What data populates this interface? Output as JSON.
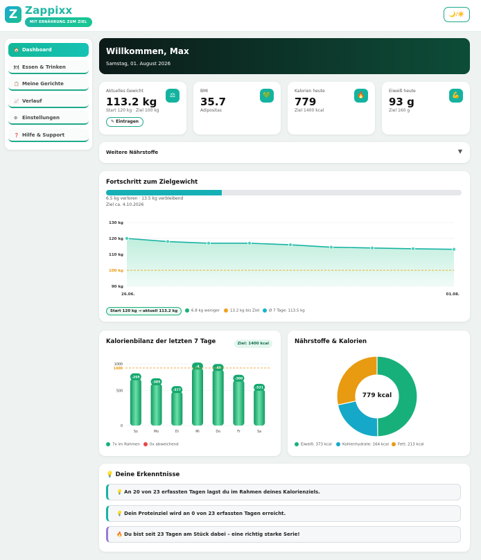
{
  "app": {
    "name": "Zappixx",
    "tagline": "MIT ERNÄHRUNG ZUM ZIEL",
    "theme_toggle": "🌙/☀️"
  },
  "sidebar": {
    "items": [
      {
        "label": "Dashboard",
        "icon": "🏠"
      },
      {
        "label": "Essen & Trinken",
        "icon": "🍽"
      },
      {
        "label": "Meine Gerichte",
        "icon": "📋"
      },
      {
        "label": "Verlauf",
        "icon": "📈"
      },
      {
        "label": "Einstellungen",
        "icon": "⚙"
      },
      {
        "label": "Hilfe & Support",
        "icon": "❓"
      }
    ]
  },
  "welcome": {
    "title": "Willkommen, Max",
    "date": "Samstag, 01. August 2026"
  },
  "stats": [
    {
      "label": "Aktuelles Gewicht",
      "value": "113.2 kg",
      "sub": "Start 120 kg · Ziel 100 kg",
      "icon": "⚖"
    },
    {
      "label": "BMI",
      "value": "35.7",
      "sub": "Adipositas",
      "icon": "💚"
    },
    {
      "label": "Kalorien heute",
      "value": "779",
      "sub": "Ziel 1400 kcal",
      "icon": "🔥"
    },
    {
      "label": "Eiweiß heute",
      "value": "93 g",
      "sub": "Ziel 160 g",
      "icon": "💪"
    }
  ],
  "entry_button": "✎ Eintragen",
  "nutrients_toggle": {
    "label": "Weitere Nährstoffe",
    "chevron": "▼"
  },
  "weight_progress": {
    "title": "Fortschritt zum Zielgewicht",
    "progress_fraction": 0.325,
    "lost_text": "6.5 kg verloren · 13.5 kg verbleibend",
    "goal_date": "Ziel ca. 4.10.2026",
    "badge": "Start 120 kg → aktuell 113.2 kg",
    "legend": [
      {
        "label": "6.8 kg weniger",
        "color": "#18b07a"
      },
      {
        "label": "13.2 kg bis Ziel",
        "color": "#f0a020"
      },
      {
        "label": "Ø 7 Tage: 113.5 kg",
        "color": "#16b3c8"
      }
    ]
  },
  "calorie_balance": {
    "title": "Kalorienbilanz der letzten 7 Tage",
    "goal_badge": "Ziel: 1400 kcal",
    "legend": [
      {
        "label": "7x im Rahmen",
        "color": "#18b07a"
      },
      {
        "label": "0x abweichend",
        "color": "#e84545"
      }
    ]
  },
  "macros": {
    "title": "Nährstoffe & Kalorien",
    "center": "779 kcal",
    "legend": [
      {
        "label": "Eiweiß: 373 kcal",
        "color": "#18b07a"
      },
      {
        "label": "Kohlenhydrate: 164 kcal",
        "color": "#16a8c8"
      },
      {
        "label": "Fett: 213 kcal",
        "color": "#e89a10"
      }
    ]
  },
  "insights": {
    "title": "Deine Erkenntnisse",
    "title_icon": "💡",
    "items": [
      {
        "icon": "💡",
        "text": "An 20 von 23 erfassten Tagen lagst du im Rahmen deines Kalorienziels."
      },
      {
        "icon": "💡",
        "text": "Dein Proteinziel wird an 0 von 23 erfassten Tagen erreicht."
      },
      {
        "icon": "🔥",
        "text": "Du bist seit 23 Tagen am Stück dabei – eine richtig starke Serie!"
      }
    ]
  },
  "chart_data": [
    {
      "type": "area",
      "title": "Fortschritt zum Zielgewicht",
      "y_ticks": [
        "130 kg",
        "120 kg",
        "110 kg",
        "100 kg",
        "90 kg"
      ],
      "ylim": [
        90,
        130
      ],
      "x_tick_labels": [
        "26.06.",
        "01.08."
      ],
      "values": [
        120,
        118,
        117,
        117,
        116,
        114.5,
        114,
        113.5,
        113.2
      ],
      "goal_line": 100,
      "colors": {
        "line": "#16b3a3",
        "goal": "#e6b020"
      }
    },
    {
      "type": "bar",
      "title": "Kalorienbilanz der letzten 7 Tage",
      "categories": [
        "So",
        "Mo",
        "Di",
        "Mi",
        "Do",
        "Fr",
        "Sa"
      ],
      "values": [
        1135,
        1015,
        823,
        1396,
        1360,
        1100,
        879
      ],
      "data_labels": [
        "-265",
        "-385",
        "-577",
        "-4",
        "-40",
        "-300",
        "-521"
      ],
      "y_ticks": [
        "1000",
        "1400",
        "500",
        "0"
      ],
      "ylim": [
        0,
        1500
      ],
      "goal_line": 1400,
      "colors": {
        "bar": "#14b073",
        "goal": "#f0a030"
      }
    },
    {
      "type": "pie",
      "title": "Nährstoffe & Kalorien",
      "labels": [
        "Eiweiß",
        "Kohlenhydrate",
        "Fett"
      ],
      "values": [
        373,
        164,
        213
      ],
      "colors": [
        "#18b07a",
        "#16a8c8",
        "#e89a10"
      ]
    }
  ]
}
